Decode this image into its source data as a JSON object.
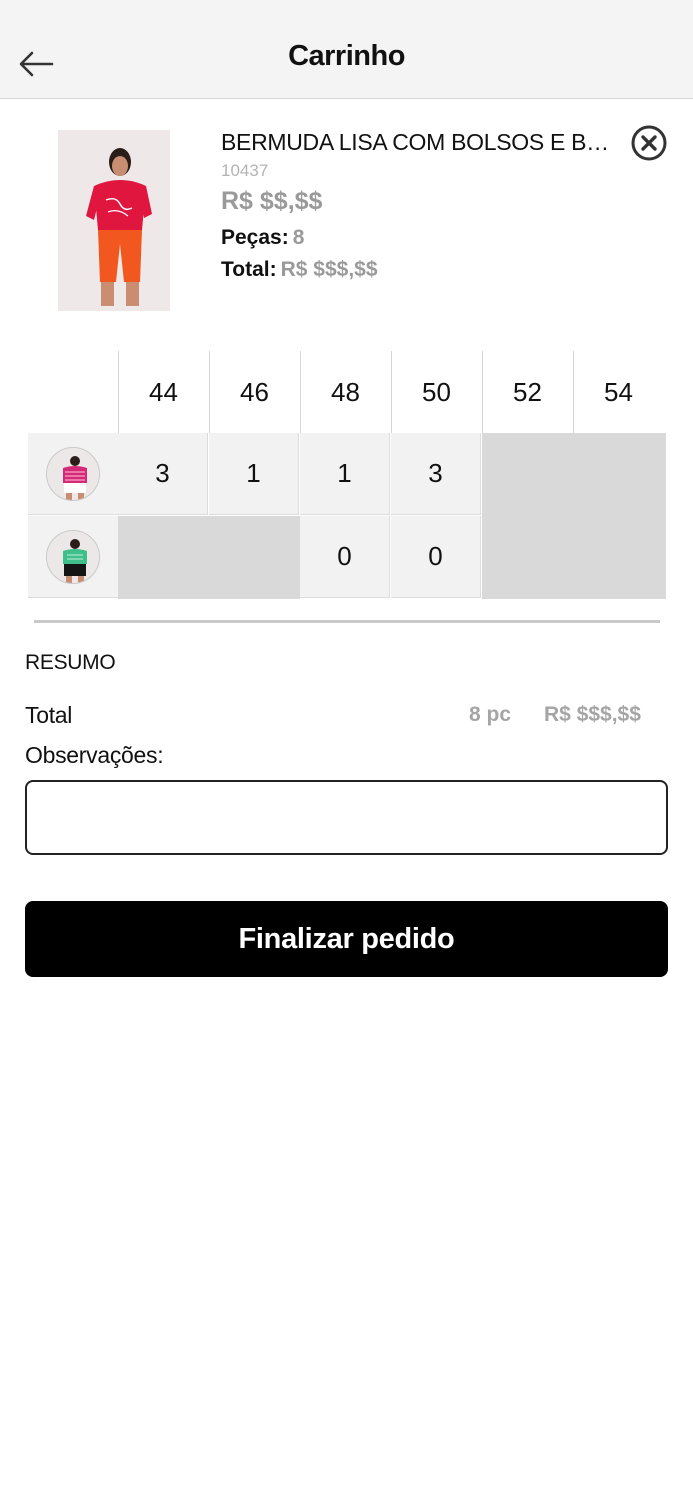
{
  "header": {
    "title": "Carrinho",
    "back_icon": "arrow-left-icon"
  },
  "product": {
    "name": "BERMUDA LISA COM BOLSOS E BOTÕES",
    "code": "10437",
    "price": "R$ $$,$$",
    "pieces_label": "Peças:",
    "pieces_value": "8",
    "total_label": "Total:",
    "total_value": "R$ $$$,$$",
    "remove_icon": "close-circle-icon"
  },
  "grid": {
    "sizes": [
      "44",
      "46",
      "48",
      "50",
      "52",
      "54"
    ],
    "rows": [
      {
        "color_thumb": "pink-top-white-bottom",
        "values": [
          "3",
          "1",
          "1",
          "3",
          null,
          null
        ]
      },
      {
        "color_thumb": "green-top-black-bottom",
        "values": [
          null,
          null,
          "0",
          "0",
          null,
          null
        ]
      }
    ]
  },
  "summary": {
    "title": "RESUMO",
    "total_label": "Total",
    "total_pieces": "8 pc",
    "total_price": "R$ $$$,$$",
    "observations_label": "Observações:",
    "observations_value": ""
  },
  "submit": {
    "label": "Finalizar pedido"
  },
  "colors": {
    "header_bg": "#f4f4f4",
    "button_bg": "#000000",
    "muted_text": "#9a9a9a",
    "disabled_cell": "#d9d9d9"
  }
}
